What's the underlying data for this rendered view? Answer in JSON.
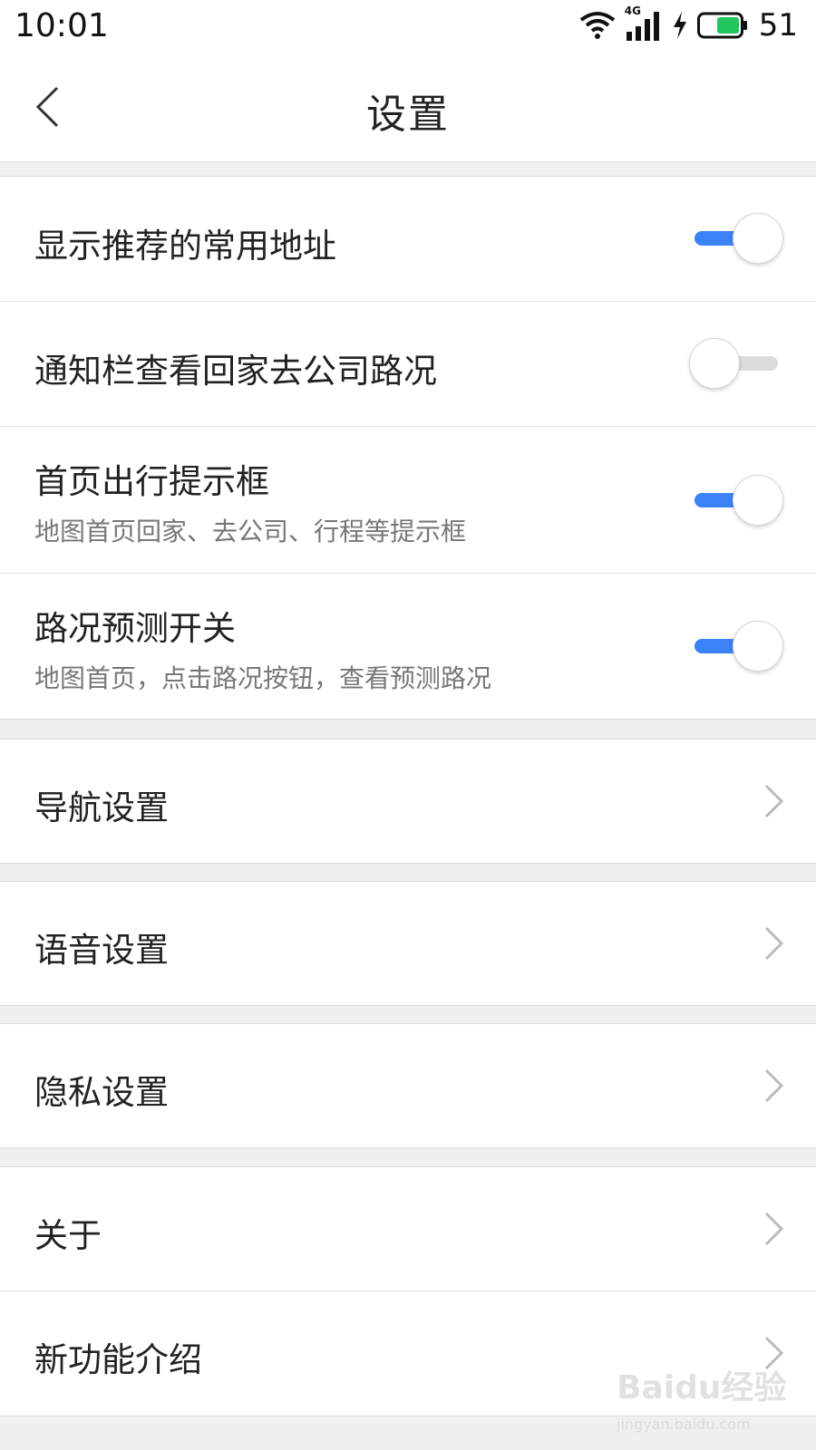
{
  "status_bar": {
    "time": "10:01",
    "network": "4G",
    "battery": "51",
    "icons": [
      "wifi-icon",
      "signal-icon",
      "charging-icon",
      "battery-icon"
    ]
  },
  "header": {
    "title": "设置",
    "back_icon": "chevron-left-icon"
  },
  "toggles": [
    {
      "label": "显示推荐的常用地址",
      "subtitle": "",
      "state": "on"
    },
    {
      "label": "通知栏查看回家去公司路况",
      "subtitle": "",
      "state": "off"
    },
    {
      "label": "首页出行提示框",
      "subtitle": "地图首页回家、去公司、行程等提示框",
      "state": "on"
    },
    {
      "label": "路况预测开关",
      "subtitle": "地图首页，点击路况按钮，查看预测路况",
      "state": "on"
    }
  ],
  "menu": [
    {
      "label": "导航设置"
    },
    {
      "label": "语音设置"
    },
    {
      "label": "隐私设置"
    },
    {
      "label": "关于"
    },
    {
      "label": "新功能介绍"
    }
  ],
  "watermark": {
    "logo": "Baidu经验",
    "url": "jingyan.baidu.com"
  },
  "colors": {
    "accent": "#3b82f6",
    "toggle_off": "#dcdcdc",
    "background": "#f0f0f0",
    "battery": "#22c55e"
  }
}
